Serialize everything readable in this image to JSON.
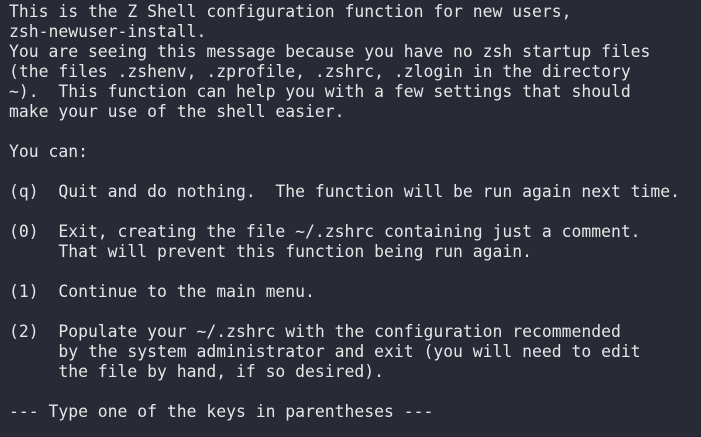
{
  "terminal": {
    "background": "#282a36",
    "foreground": "#e6e6e6",
    "lines": [
      "This is the Z Shell configuration function for new users,",
      "zsh-newuser-install.",
      "You are seeing this message because you have no zsh startup files",
      "(the files .zshenv, .zprofile, .zshrc, .zlogin in the directory",
      "~).  This function can help you with a few settings that should",
      "make your use of the shell easier.",
      "",
      "You can:",
      "",
      "(q)  Quit and do nothing.  The function will be run again next time.",
      "",
      "(0)  Exit, creating the file ~/.zshrc containing just a comment.",
      "     That will prevent this function being run again.",
      "",
      "(1)  Continue to the main menu.",
      "",
      "(2)  Populate your ~/.zshrc with the configuration recommended",
      "     by the system administrator and exit (you will need to edit",
      "     the file by hand, if so desired).",
      "",
      "--- Type one of the keys in parentheses ---"
    ]
  }
}
